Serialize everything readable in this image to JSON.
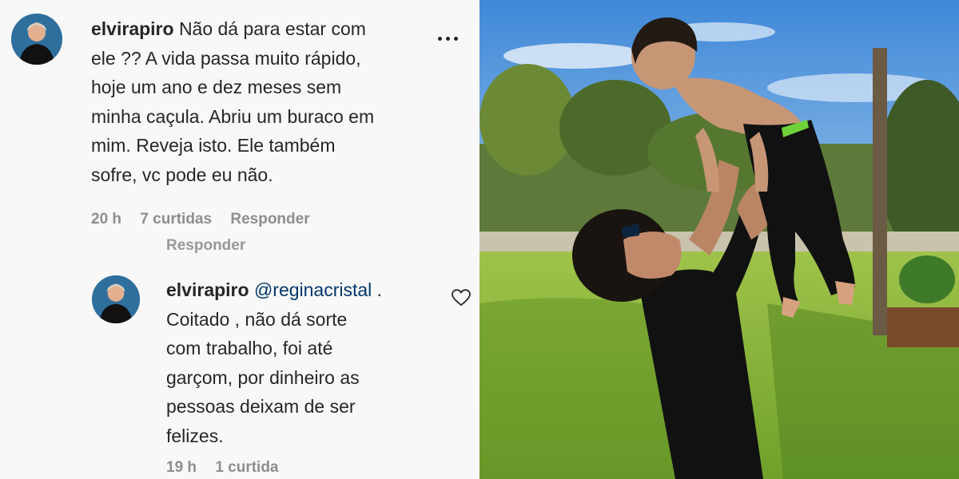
{
  "comment1": {
    "username": "elvirapiro",
    "lines": [
      "Não dá para estar com",
      "ele ?? A vida passa muito rápido,",
      "hoje um ano e dez meses sem",
      "minha caçula. Abriu um buraco em",
      "mim. Reveja isto. Ele também",
      "sofre, vc pode eu não."
    ],
    "time": "20 h",
    "likes": "7 curtidas",
    "reply_label": "Responder"
  },
  "reply_ghost_label": "Responder",
  "comment2": {
    "username": "elvirapiro",
    "mention": "@reginacristal",
    "after_mention": " .",
    "lines": [
      "Coitado , não dá sorte",
      "com trabalho, foi até",
      "garçom, por dinheiro as",
      "pessoas deixam de ser",
      "felizes."
    ],
    "time": "19 h",
    "likes": "1 curtida"
  },
  "icons": {
    "more": "more-options-icon",
    "like": "heart-icon"
  },
  "colors": {
    "text": "#262626",
    "muted": "#8e8e8e",
    "mention": "#00376b",
    "avatar_bg": "#2f6f9e"
  }
}
